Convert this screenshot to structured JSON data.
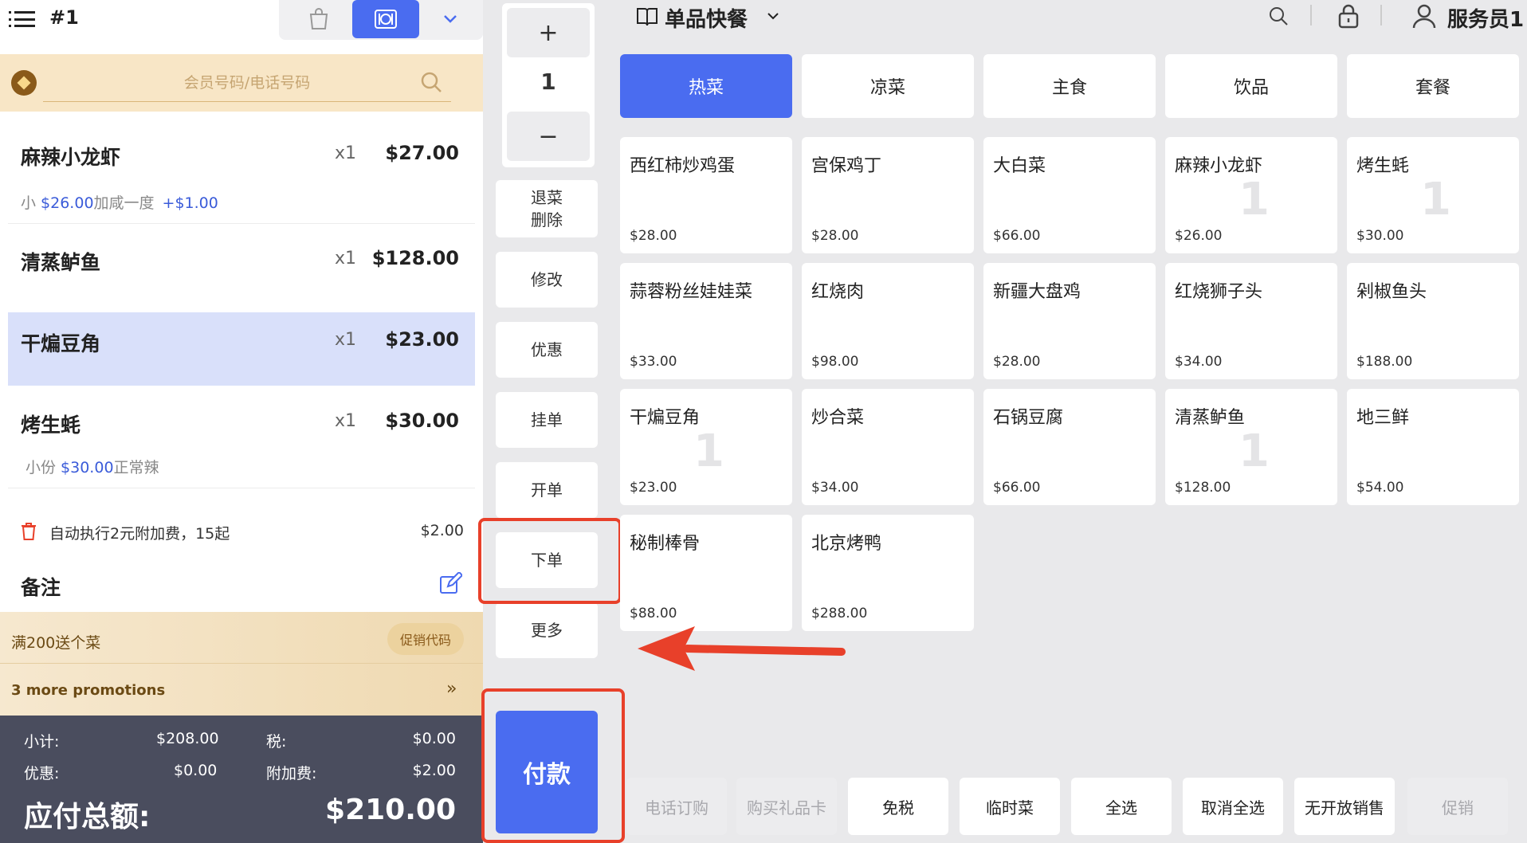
{
  "order": {
    "number": "#1"
  },
  "member": {
    "placeholder": "会员号码/电话号码"
  },
  "cart": {
    "items": [
      {
        "name": "麻辣小龙虾",
        "qty": "x1",
        "price": "$27.00",
        "sub_prefix": "小 ",
        "sub_price": "$26.00",
        "sub_suffix": "加咸一度",
        "sub_extra": "+$1.00"
      },
      {
        "name": "清蒸鲈鱼",
        "qty": "x1",
        "price": "$128.00"
      },
      {
        "name": "干煸豆角",
        "qty": "x1",
        "price": "$23.00",
        "selected": true
      },
      {
        "name": "烤生蚝",
        "qty": "x1",
        "price": "$30.00",
        "sub_prefix": "小份 ",
        "sub_price": "$30.00",
        "sub_suffix": "正常辣"
      }
    ],
    "surcharge": {
      "text": "自动执行2元附加费，15起",
      "amount": "$2.00"
    },
    "notes_label": "备注"
  },
  "promo": {
    "title": "满200送个菜",
    "code_button": "促销代码",
    "more": "3 more promotions",
    "arrow": "»"
  },
  "totals": {
    "subtotal_label": "小计:",
    "subtotal": "$208.00",
    "tax_label": "税:",
    "tax": "$0.00",
    "discount_label": "优惠:",
    "discount": "$0.00",
    "fee_label": "附加费:",
    "fee": "$2.00",
    "grand_label": "应付总额:",
    "grand": "$210.00"
  },
  "actions": {
    "plus": "+",
    "qty": "1",
    "minus": "−",
    "void": "退菜\n删除",
    "edit": "修改",
    "discount": "优惠",
    "hold": "挂单",
    "open": "开单",
    "place_order": "下单",
    "more": "更多",
    "pay": "付款"
  },
  "header": {
    "menu_title": "单品快餐",
    "user": "服务员1"
  },
  "categories": [
    "热菜",
    "凉菜",
    "主食",
    "饮品",
    "套餐"
  ],
  "dishes": [
    {
      "name": "西红柿炒鸡蛋",
      "price": "$28.00",
      "count": ""
    },
    {
      "name": "宫保鸡丁",
      "price": "$28.00",
      "count": ""
    },
    {
      "name": "大白菜",
      "price": "$66.00",
      "count": ""
    },
    {
      "name": "麻辣小龙虾",
      "price": "$26.00",
      "count": "1"
    },
    {
      "name": "烤生蚝",
      "price": "$30.00",
      "count": "1"
    },
    {
      "name": "蒜蓉粉丝娃娃菜",
      "price": "$33.00",
      "count": ""
    },
    {
      "name": "红烧肉",
      "price": "$98.00",
      "count": ""
    },
    {
      "name": "新疆大盘鸡",
      "price": "$28.00",
      "count": ""
    },
    {
      "name": "红烧狮子头",
      "price": "$34.00",
      "count": ""
    },
    {
      "name": "剁椒鱼头",
      "price": "$188.00",
      "count": ""
    },
    {
      "name": "干煸豆角",
      "price": "$23.00",
      "count": "1"
    },
    {
      "name": "炒合菜",
      "price": "$34.00",
      "count": ""
    },
    {
      "name": "石锅豆腐",
      "price": "$66.00",
      "count": ""
    },
    {
      "name": "清蒸鲈鱼",
      "price": "$128.00",
      "count": "1"
    },
    {
      "name": "地三鲜",
      "price": "$54.00",
      "count": ""
    },
    {
      "name": "秘制棒骨",
      "price": "$88.00",
      "count": ""
    },
    {
      "name": "北京烤鸭",
      "price": "$288.00",
      "count": ""
    }
  ],
  "bottom_buttons": [
    {
      "label": "电话订购",
      "disabled": true
    },
    {
      "label": "购买礼品卡",
      "disabled": true
    },
    {
      "label": "免税",
      "disabled": false
    },
    {
      "label": "临时菜",
      "disabled": false
    },
    {
      "label": "全选",
      "disabled": false
    },
    {
      "label": "取消全选",
      "disabled": false
    },
    {
      "label": "无开放销售",
      "disabled": false
    },
    {
      "label": "促销",
      "disabled": true
    }
  ],
  "colors": {
    "accent": "#4a6cf0",
    "highlight": "#e8402a",
    "totals_bg": "#4a4d5e",
    "member_bg": "#f8e6c6"
  }
}
